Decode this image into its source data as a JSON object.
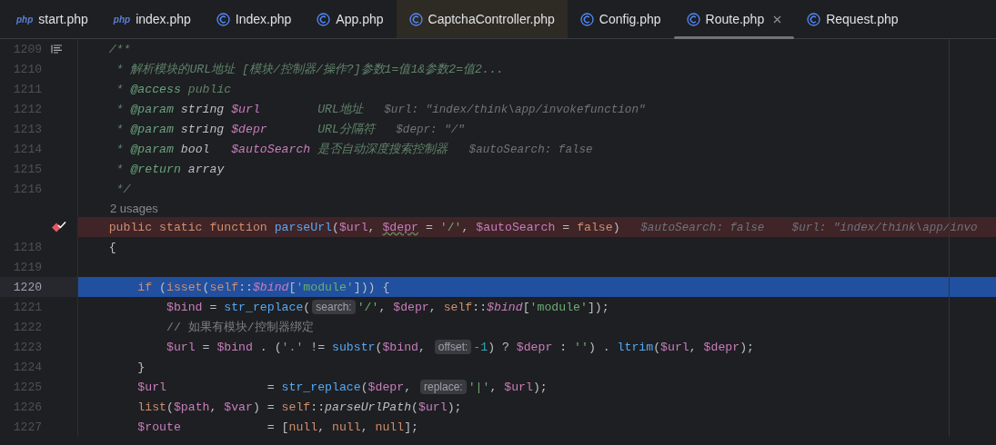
{
  "tabs": [
    {
      "label": "start.php",
      "icon": {
        "kind": "php",
        "text": "php"
      },
      "selected": false,
      "highlighted": false
    },
    {
      "label": "index.php",
      "icon": {
        "kind": "php",
        "text": "php"
      },
      "selected": false,
      "highlighted": false
    },
    {
      "label": "Index.php",
      "icon": {
        "kind": "class"
      },
      "selected": false,
      "highlighted": false
    },
    {
      "label": "App.php",
      "icon": {
        "kind": "class"
      },
      "selected": false,
      "highlighted": false
    },
    {
      "label": "CaptchaController.php",
      "icon": {
        "kind": "class"
      },
      "selected": false,
      "highlighted": true
    },
    {
      "label": "Config.php",
      "icon": {
        "kind": "class"
      },
      "selected": false,
      "highlighted": false
    },
    {
      "label": "Route.php",
      "icon": {
        "kind": "class"
      },
      "selected": true,
      "highlighted": false
    },
    {
      "label": "Request.php",
      "icon": {
        "kind": "class"
      },
      "selected": false,
      "highlighted": false
    }
  ],
  "editor": {
    "lines": [
      {
        "kind": "code",
        "number": "1209",
        "marker": {
          "kind": "doc"
        },
        "breakpoint": false,
        "execution": false,
        "tokens": [
          {
            "text": "    /**",
            "kind": "doc"
          }
        ]
      },
      {
        "kind": "code",
        "number": "1210",
        "breakpoint": false,
        "execution": false,
        "tokens": [
          {
            "text": "     * 解析模块的URL地址 [模块/控制器/操作?]参数1=值1&参数2=值2...",
            "kind": "doc"
          }
        ]
      },
      {
        "kind": "code",
        "number": "1211",
        "breakpoint": false,
        "execution": false,
        "tokens": [
          {
            "text": "     * ",
            "kind": "doc"
          },
          {
            "text": "@access",
            "kind": "doctag"
          },
          {
            "text": " public",
            "kind": "doc"
          }
        ]
      },
      {
        "kind": "code",
        "number": "1212",
        "breakpoint": false,
        "execution": false,
        "tokens": [
          {
            "text": "     * ",
            "kind": "doc"
          },
          {
            "text": "@param",
            "kind": "doctag"
          },
          {
            "text": " string ",
            "kind": "doctype"
          },
          {
            "text": "$url",
            "kind": "docvar"
          },
          {
            "text": "        URL地址  ",
            "kind": "doc"
          },
          {
            "text": " $url: \"index/think\\app/invokefunction\"",
            "kind": "debug"
          }
        ]
      },
      {
        "kind": "code",
        "number": "1213",
        "breakpoint": false,
        "execution": false,
        "tokens": [
          {
            "text": "     * ",
            "kind": "doc"
          },
          {
            "text": "@param",
            "kind": "doctag"
          },
          {
            "text": " string ",
            "kind": "doctype"
          },
          {
            "text": "$depr",
            "kind": "docvar"
          },
          {
            "text": "       URL分隔符  ",
            "kind": "doc"
          },
          {
            "text": " $depr: \"/\"",
            "kind": "debug"
          }
        ]
      },
      {
        "kind": "code",
        "number": "1214",
        "breakpoint": false,
        "execution": false,
        "tokens": [
          {
            "text": "     * ",
            "kind": "doc"
          },
          {
            "text": "@param",
            "kind": "doctag"
          },
          {
            "text": " bool   ",
            "kind": "doctype"
          },
          {
            "text": "$autoSearch",
            "kind": "docvar"
          },
          {
            "text": " 是否自动深度搜索控制器  ",
            "kind": "doc"
          },
          {
            "text": " $autoSearch: false",
            "kind": "debug"
          }
        ]
      },
      {
        "kind": "code",
        "number": "1215",
        "breakpoint": false,
        "execution": false,
        "tokens": [
          {
            "text": "     * ",
            "kind": "doc"
          },
          {
            "text": "@return",
            "kind": "doctag"
          },
          {
            "text": " array",
            "kind": "doctype"
          }
        ]
      },
      {
        "kind": "code",
        "number": "1216",
        "breakpoint": false,
        "execution": false,
        "tokens": [
          {
            "text": "     */",
            "kind": "doc"
          }
        ]
      },
      {
        "kind": "usages",
        "text": "2 usages"
      },
      {
        "kind": "code",
        "marker": {
          "kind": "breakpoint"
        },
        "breakpoint": true,
        "execution": false,
        "tokens": [
          {
            "text": "    public static function ",
            "kind": "keyword"
          },
          {
            "text": "parseUrl",
            "kind": "func"
          },
          {
            "text": "(",
            "kind": "plain"
          },
          {
            "text": "$url",
            "kind": "var"
          },
          {
            "text": ", ",
            "kind": "plain"
          },
          {
            "text": "$depr",
            "kind": "var_warn"
          },
          {
            "text": " = ",
            "kind": "plain"
          },
          {
            "text": "'/'",
            "kind": "string"
          },
          {
            "text": ", ",
            "kind": "plain"
          },
          {
            "text": "$autoSearch",
            "kind": "var"
          },
          {
            "text": " = ",
            "kind": "plain"
          },
          {
            "text": "false",
            "kind": "keyword"
          },
          {
            "text": ")",
            "kind": "plain"
          },
          {
            "text": "   $autoSearch: false",
            "kind": "debug"
          },
          {
            "text": "    $url: \"index/think\\app/invo",
            "kind": "debug"
          }
        ]
      },
      {
        "kind": "code",
        "number": "1218",
        "breakpoint": false,
        "execution": false,
        "tokens": [
          {
            "text": "    {",
            "kind": "plain"
          }
        ]
      },
      {
        "kind": "code",
        "number": "1219",
        "breakpoint": false,
        "execution": false
      },
      {
        "kind": "code",
        "number": "1220",
        "breakpoint": false,
        "execution": true,
        "tokens": [
          {
            "text": "        if",
            "kind": "keyword"
          },
          {
            "text": " (",
            "kind": "plain"
          },
          {
            "text": "isset",
            "kind": "keyword"
          },
          {
            "text": "(",
            "kind": "plain"
          },
          {
            "text": "self",
            "kind": "keyword"
          },
          {
            "text": "::",
            "kind": "plain"
          },
          {
            "text": "$bind",
            "kind": "var_italic"
          },
          {
            "text": "[",
            "kind": "plain"
          },
          {
            "text": "'module'",
            "kind": "string"
          },
          {
            "text": "])) {",
            "kind": "plain"
          }
        ]
      },
      {
        "kind": "code",
        "number": "1221",
        "breakpoint": false,
        "execution": false,
        "tokens": [
          {
            "text": "            $bind",
            "kind": "var"
          },
          {
            "text": " = ",
            "kind": "plain"
          },
          {
            "text": "str_replace",
            "kind": "func"
          },
          {
            "text": "(",
            "kind": "plain"
          },
          {
            "text": "search:",
            "kind": "hint"
          },
          {
            "text": "'/'",
            "kind": "string"
          },
          {
            "text": ", ",
            "kind": "plain"
          },
          {
            "text": "$depr",
            "kind": "var"
          },
          {
            "text": ", ",
            "kind": "plain"
          },
          {
            "text": "self",
            "kind": "keyword"
          },
          {
            "text": "::",
            "kind": "plain"
          },
          {
            "text": "$bind",
            "kind": "var_italic"
          },
          {
            "text": "[",
            "kind": "plain"
          },
          {
            "text": "'module'",
            "kind": "string"
          },
          {
            "text": "]);",
            "kind": "plain"
          }
        ]
      },
      {
        "kind": "code",
        "number": "1222",
        "breakpoint": false,
        "execution": false,
        "tokens": [
          {
            "text": "            // 如果有模块/控制器绑定",
            "kind": "comment"
          }
        ]
      },
      {
        "kind": "code",
        "number": "1223",
        "breakpoint": false,
        "execution": false,
        "tokens": [
          {
            "text": "            $url",
            "kind": "var"
          },
          {
            "text": " = ",
            "kind": "plain"
          },
          {
            "text": "$bind",
            "kind": "var"
          },
          {
            "text": " . (",
            "kind": "plain"
          },
          {
            "text": "'.'",
            "kind": "string"
          },
          {
            "text": " != ",
            "kind": "plain"
          },
          {
            "text": "substr",
            "kind": "func"
          },
          {
            "text": "(",
            "kind": "plain"
          },
          {
            "text": "$bind",
            "kind": "var"
          },
          {
            "text": ", ",
            "kind": "plain"
          },
          {
            "text": "offset:",
            "kind": "hint"
          },
          {
            "text": "-1",
            "kind": "number"
          },
          {
            "text": ") ? ",
            "kind": "plain"
          },
          {
            "text": "$depr",
            "kind": "var"
          },
          {
            "text": " : ",
            "kind": "plain"
          },
          {
            "text": "''",
            "kind": "string"
          },
          {
            "text": ") . ",
            "kind": "plain"
          },
          {
            "text": "ltrim",
            "kind": "func"
          },
          {
            "text": "(",
            "kind": "plain"
          },
          {
            "text": "$url",
            "kind": "var"
          },
          {
            "text": ", ",
            "kind": "plain"
          },
          {
            "text": "$depr",
            "kind": "var"
          },
          {
            "text": ");",
            "kind": "plain"
          }
        ]
      },
      {
        "kind": "code",
        "number": "1224",
        "breakpoint": false,
        "execution": false,
        "tokens": [
          {
            "text": "        }",
            "kind": "plain"
          }
        ]
      },
      {
        "kind": "code",
        "number": "1225",
        "breakpoint": false,
        "execution": false,
        "tokens": [
          {
            "text": "        $url",
            "kind": "var"
          },
          {
            "text": "              = ",
            "kind": "plain"
          },
          {
            "text": "str_replace",
            "kind": "func"
          },
          {
            "text": "(",
            "kind": "plain"
          },
          {
            "text": "$depr",
            "kind": "var"
          },
          {
            "text": ", ",
            "kind": "plain"
          },
          {
            "text": "replace:",
            "kind": "hint"
          },
          {
            "text": "'|'",
            "kind": "string"
          },
          {
            "text": ", ",
            "kind": "plain"
          },
          {
            "text": "$url",
            "kind": "var"
          },
          {
            "text": ");",
            "kind": "plain"
          }
        ]
      },
      {
        "kind": "code",
        "number": "1226",
        "breakpoint": false,
        "execution": false,
        "tokens": [
          {
            "text": "        list",
            "kind": "keyword"
          },
          {
            "text": "(",
            "kind": "plain"
          },
          {
            "text": "$path",
            "kind": "var"
          },
          {
            "text": ", ",
            "kind": "plain"
          },
          {
            "text": "$var",
            "kind": "var"
          },
          {
            "text": ") = ",
            "kind": "plain"
          },
          {
            "text": "self",
            "kind": "keyword"
          },
          {
            "text": "::",
            "kind": "plain"
          },
          {
            "text": "parseUrlPath",
            "kind": "method_italic"
          },
          {
            "text": "(",
            "kind": "plain"
          },
          {
            "text": "$url",
            "kind": "var"
          },
          {
            "text": ");",
            "kind": "plain"
          }
        ]
      },
      {
        "kind": "code",
        "number": "1227",
        "breakpoint": false,
        "execution": false,
        "tokens": [
          {
            "text": "        $route",
            "kind": "var"
          },
          {
            "text": "            = [",
            "kind": "plain"
          },
          {
            "text": "null",
            "kind": "keyword"
          },
          {
            "text": ", ",
            "kind": "plain"
          },
          {
            "text": "null",
            "kind": "keyword"
          },
          {
            "text": ", ",
            "kind": "plain"
          },
          {
            "text": "null",
            "kind": "keyword"
          },
          {
            "text": "];",
            "kind": "plain"
          }
        ]
      }
    ]
  }
}
